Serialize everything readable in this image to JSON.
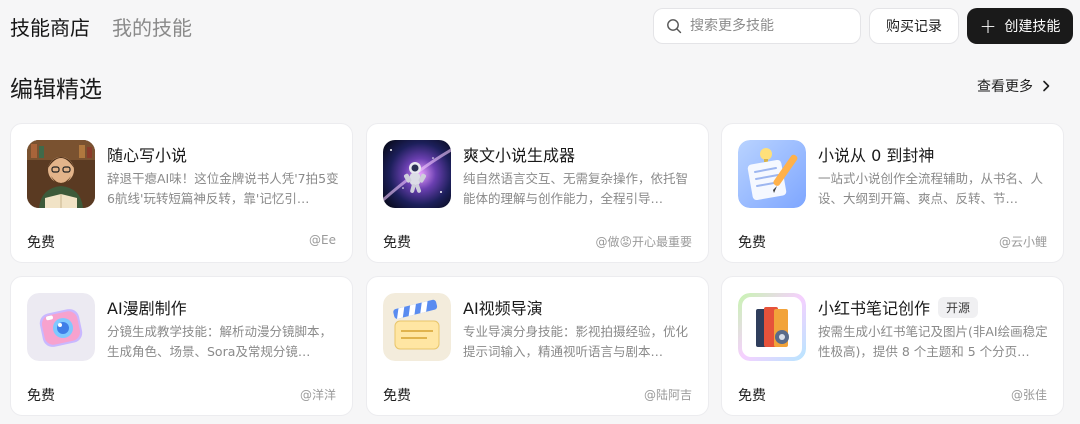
{
  "tabs": [
    {
      "label": "技能商店",
      "active": true
    },
    {
      "label": "我的技能",
      "active": false
    }
  ],
  "search": {
    "placeholder": "搜索更多技能"
  },
  "toolbar": {
    "purchase_label": "购买记录",
    "create_label": "创建技能"
  },
  "section": {
    "title": "编辑精选",
    "see_more": "查看更多"
  },
  "cards": [
    {
      "name": "随心写小说",
      "desc": "辞退干瘪AI味！这位金牌说书人凭'7拍5变6航线'玩转短篇神反转，靠'记忆引…",
      "price": "免费",
      "author": "@Ee",
      "icon": "storyteller-avatar-icon",
      "badge": ""
    },
    {
      "name": "爽文小说生成器",
      "desc": "纯自然语言交互、无需复杂操作，依托智能体的理解与创作能力，全程引导…",
      "price": "免费",
      "author": "@做😡开心最重要",
      "icon": "astronaut-galaxy-icon",
      "badge": ""
    },
    {
      "name": "小说从 0 到封神",
      "desc": "一站式小说创作全流程辅助，从书名、人设、大纲到开篇、爽点、反转、节…",
      "price": "免费",
      "author": "@云小鲤",
      "icon": "document-pen-icon",
      "badge": ""
    },
    {
      "name": "AI漫剧制作",
      "desc": "分镜生成教学技能：解析动漫分镜脚本，生成角色、场景、Sora及常规分镜…",
      "price": "免费",
      "author": "@洋洋",
      "icon": "camera-icon",
      "badge": ""
    },
    {
      "name": "AI视频导演",
      "desc": "专业导演分身技能：影视拍摄经验，优化提示词输入，精通视听语言与剧本…",
      "price": "免费",
      "author": "@陆阿吉",
      "icon": "clapperboard-icon",
      "badge": ""
    },
    {
      "name": "小红书笔记创作",
      "desc": "按需生成小红书笔记及图片(非AI绘画稳定性极高)，提供 8 个主题和 5 个分页…",
      "price": "免费",
      "author": "@张佳",
      "icon": "notebook-gear-icon",
      "badge": "开源"
    }
  ],
  "colors": {
    "accent_dark": "#1a1a1a",
    "page_bg": "#f6f6f7",
    "muted_text": "#8a8a8a"
  }
}
